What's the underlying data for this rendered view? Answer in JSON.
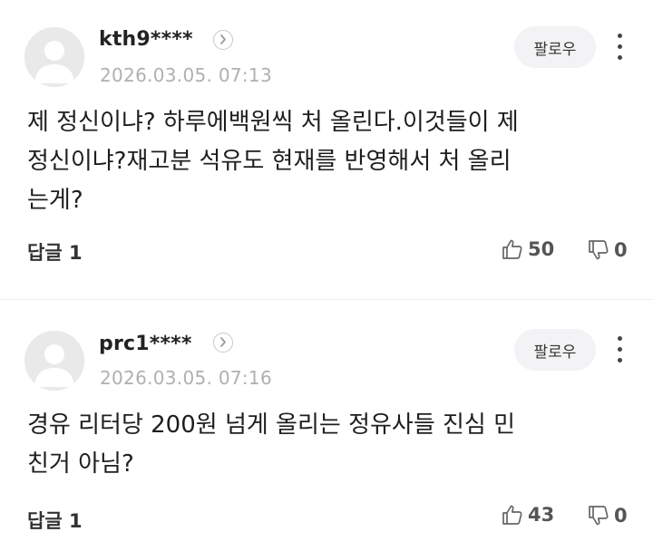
{
  "comments": [
    {
      "username": "kth9****",
      "timestamp": "2026.03.05. 07:13",
      "follow_label": "팔로우",
      "body": "제 정신이냐? 하루에백원씩 처 올린다.이것들이 제\n정신이냐?재고분 석유도 현재를 반영해서 처 올리\n는게?",
      "reply_label": "답글 1",
      "likes": "50",
      "dislikes": "0"
    },
    {
      "username": "prc1****",
      "timestamp": "2026.03.05. 07:16",
      "follow_label": "팔로우",
      "body": "경유 리터당 200원 넘게 올리는 정유사들 진심 민\n친거 아님?",
      "reply_label": "답글 1",
      "likes": "43",
      "dislikes": "0"
    }
  ],
  "icons": {
    "avatar": "default-avatar-icon",
    "profile_arrow": "chevron-right-icon",
    "more": "more-vertical-icon",
    "like": "thumbs-up-icon",
    "dislike": "thumbs-down-icon"
  },
  "colors": {
    "avatar_bg": "#e9e9e9",
    "avatar_fg": "#ffffff",
    "follow_bg": "#f3f3f5",
    "timestamp": "#b0b0b0",
    "divider": "#ececec"
  }
}
